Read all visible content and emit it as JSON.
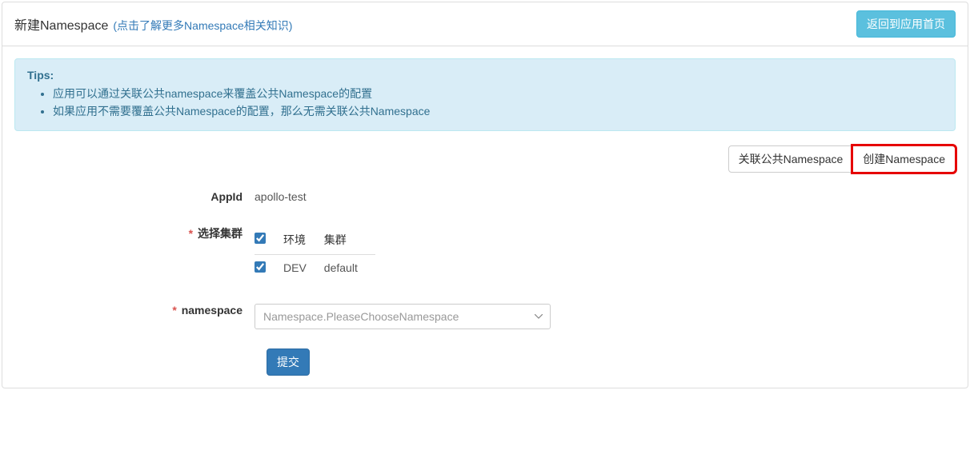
{
  "header": {
    "title": "新建Namespace",
    "help_link": "(点击了解更多Namespace相关知识)",
    "back_button": "返回到应用首页"
  },
  "tips": {
    "label": "Tips:",
    "items": [
      "应用可以通过关联公共namespace来覆盖公共Namespace的配置",
      "如果应用不需要覆盖公共Namespace的配置，那么无需关联公共Namespace"
    ]
  },
  "tabs": {
    "associate": "关联公共Namespace",
    "create": "创建Namespace"
  },
  "form": {
    "appid_label": "AppId",
    "appid_value": "apollo-test",
    "cluster_label": "选择集群",
    "cluster_headers": {
      "env": "环境",
      "cluster": "集群"
    },
    "cluster_rows": [
      {
        "env": "DEV",
        "cluster": "default",
        "checked": true
      }
    ],
    "namespace_label": "namespace",
    "namespace_placeholder": "Namespace.PleaseChooseNamespace",
    "submit": "提交"
  }
}
